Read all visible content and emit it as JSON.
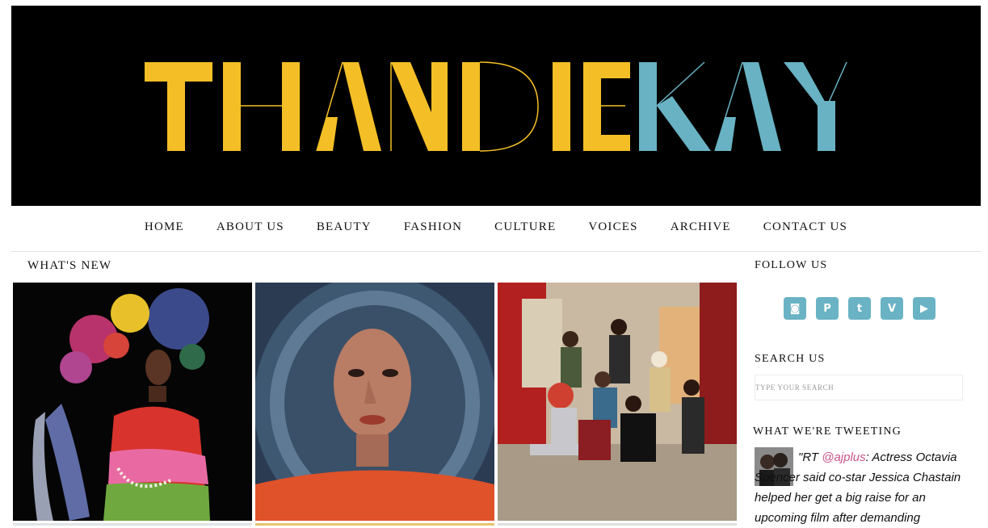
{
  "brand": {
    "part1": "THANDIE",
    "part2": "KAY",
    "color1": "#f4bf26",
    "color2": "#68b2c3"
  },
  "nav": {
    "items": [
      {
        "label": "HOME"
      },
      {
        "label": "ABOUT US"
      },
      {
        "label": "BEAUTY"
      },
      {
        "label": "FASHION"
      },
      {
        "label": "CULTURE"
      },
      {
        "label": "VOICES"
      },
      {
        "label": "ARCHIVE"
      },
      {
        "label": "CONTACT US"
      }
    ]
  },
  "main": {
    "whats_new_title": "WHAT'S NEW"
  },
  "sidebar": {
    "follow_title": "FOLLOW US",
    "social_icons": [
      {
        "name": "instagram-icon",
        "glyph": "◙"
      },
      {
        "name": "pinterest-icon",
        "glyph": "P"
      },
      {
        "name": "twitter-icon",
        "glyph": "t"
      },
      {
        "name": "vimeo-icon",
        "glyph": "V"
      },
      {
        "name": "youtube-icon",
        "glyph": "▶"
      }
    ],
    "search_title": "SEARCH US",
    "search_placeholder": "TYPE YOUR SEARCH",
    "tweet_title": "WHAT WE'RE TWEETING",
    "tweet_prefix": "\"RT ",
    "tweet_handle": "@ajplus",
    "tweet_text": ": Actress Octavia Spencer said co-star Jessica Chastain helped her get a big raise for an upcoming film after demanding"
  }
}
